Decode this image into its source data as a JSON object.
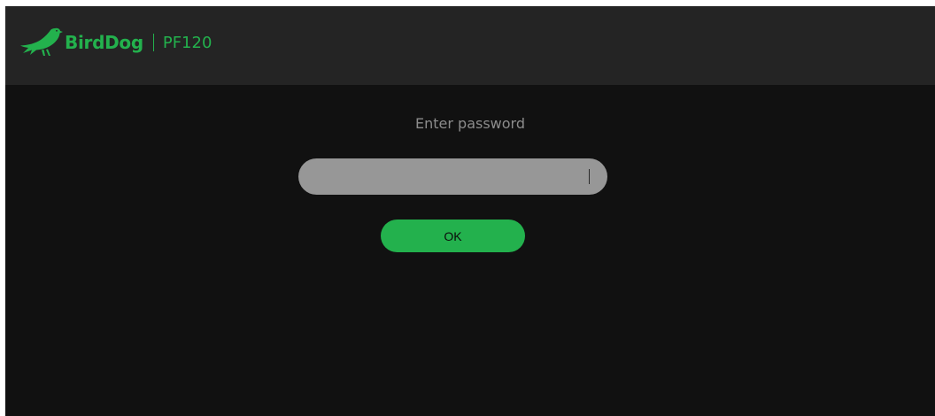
{
  "header": {
    "brand_name": "BirdDog",
    "model_name": "PF120",
    "logo_icon": "bird-icon",
    "brand_color": "#23b14d"
  },
  "login": {
    "title": "Enter password",
    "password_value": "",
    "ok_label": "OK"
  },
  "colors": {
    "header_bg": "#242424",
    "page_bg": "#111111",
    "input_bg": "#979797",
    "button_bg": "#23b14d",
    "title_text": "#8c8c8c"
  }
}
